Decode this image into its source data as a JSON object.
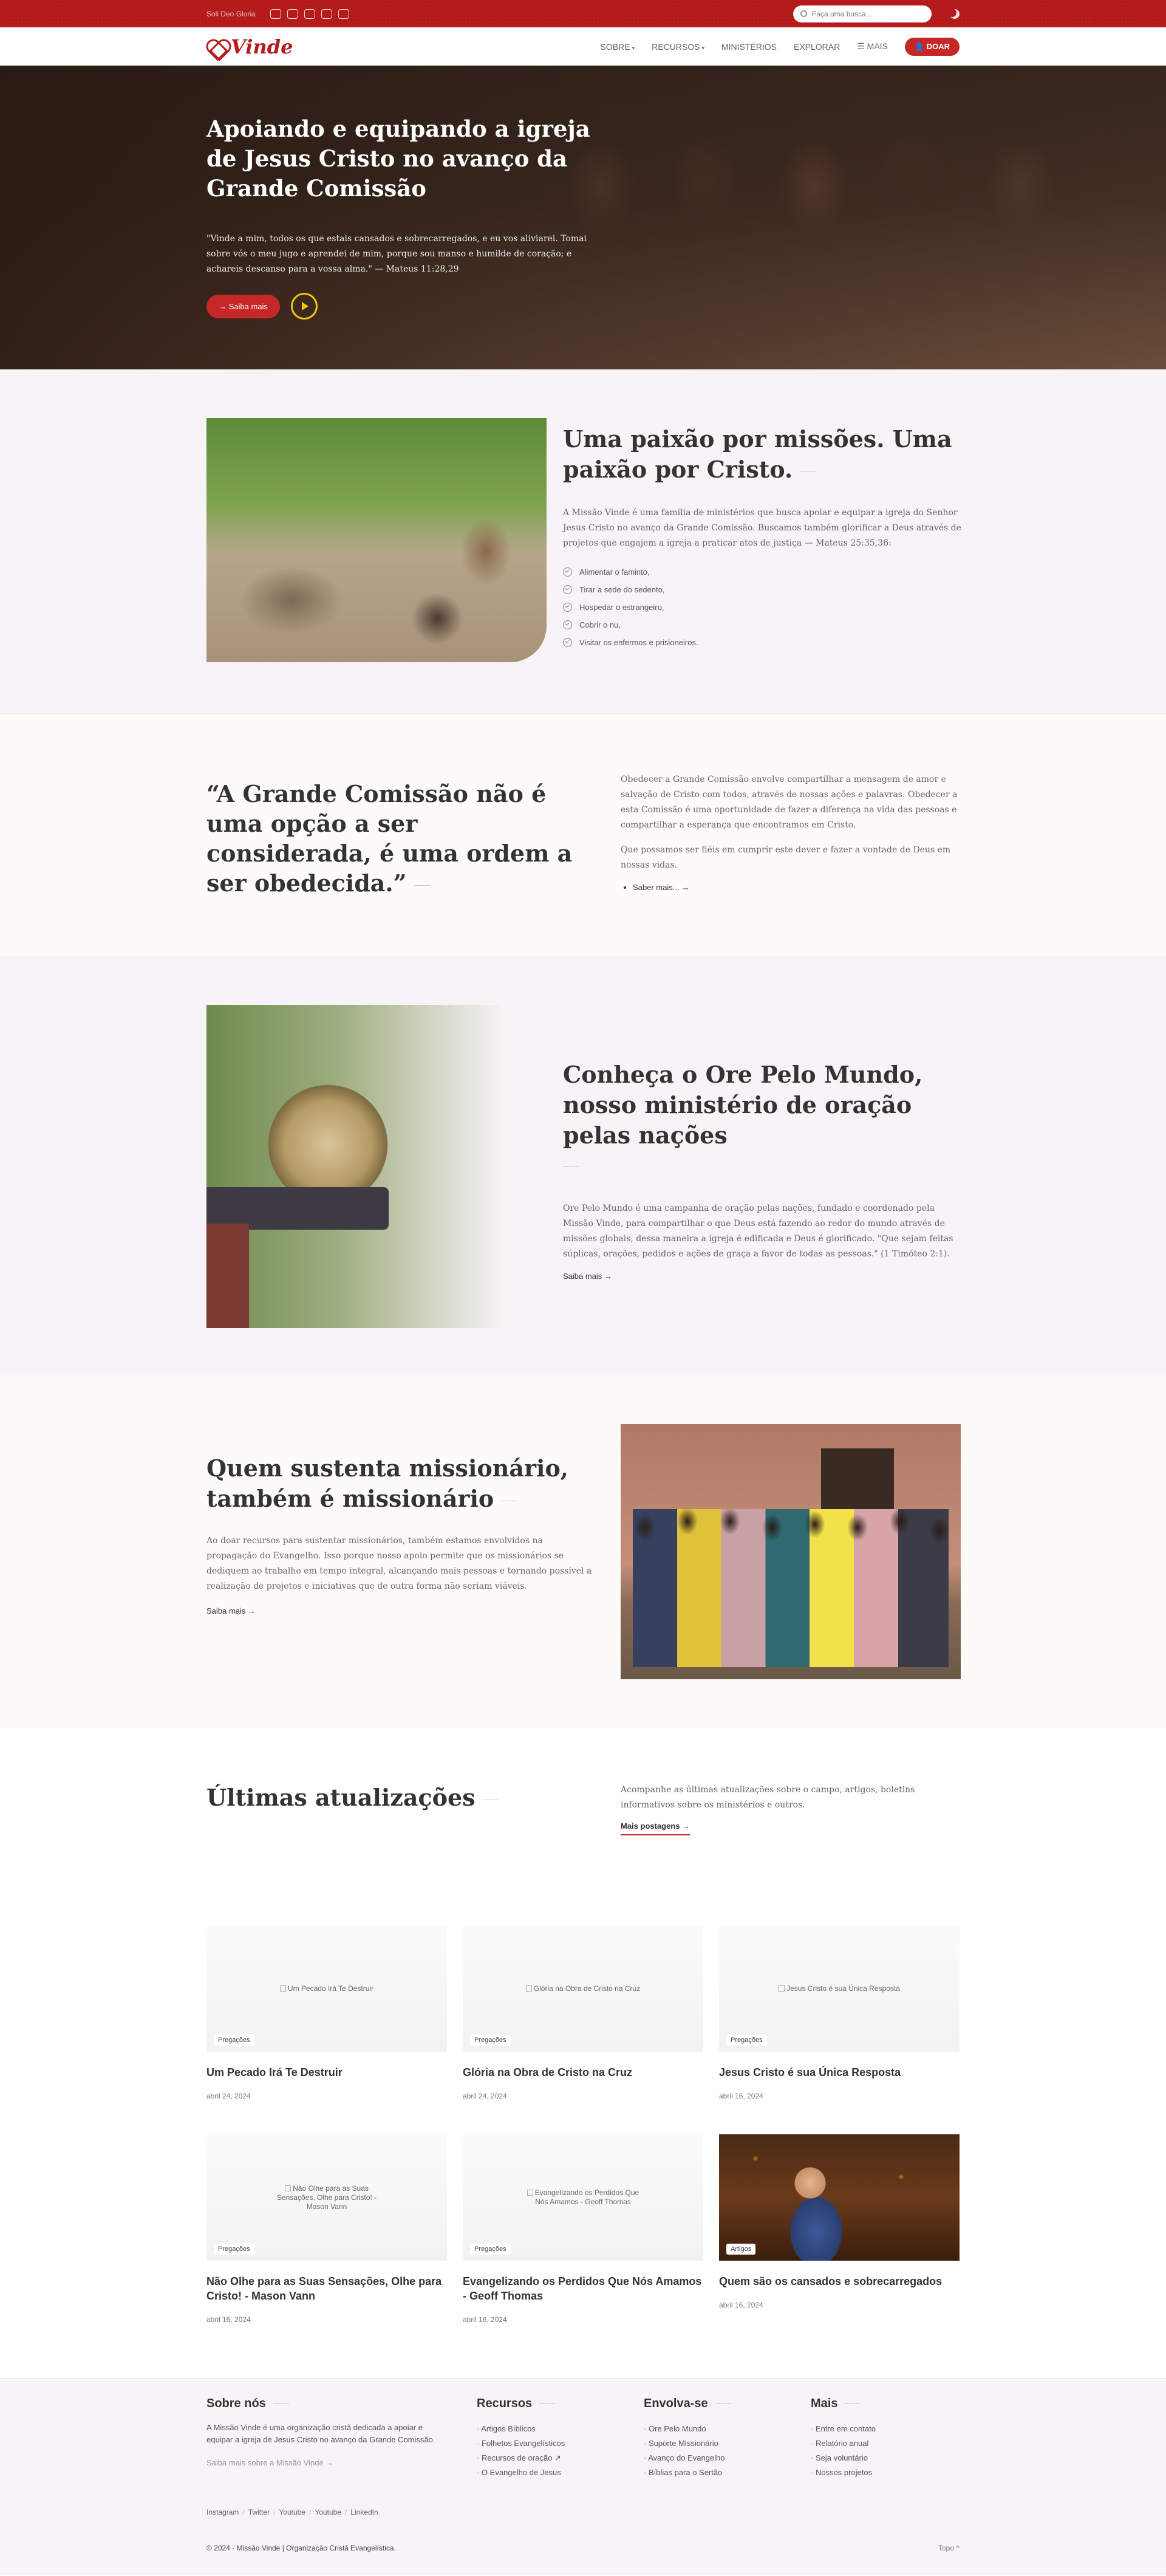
{
  "topbar": {
    "motto": "Soli Deo Gloria",
    "socials": [
      "facebook-icon",
      "bluesky-icon",
      "instagram-icon",
      "youtube-icon",
      "telegram-icon"
    ],
    "search_placeholder": "Faça uma busca..."
  },
  "header": {
    "brand": "Vinde",
    "nav": [
      {
        "label": "SOBRE",
        "dropdown": true
      },
      {
        "label": "RECURSOS",
        "dropdown": true
      },
      {
        "label": "MINISTÉRIOS",
        "dropdown": false
      },
      {
        "label": "EXPLORAR",
        "dropdown": false
      },
      {
        "label": "☰ MAIS",
        "dropdown": false
      }
    ],
    "donate": "DOAR"
  },
  "hero": {
    "title": "Apoiando e equipando a igreja de Jesus Cristo no avanço da Grande Comissão",
    "quote": "\"Vinde a mim, todos os que estais cansados e sobrecarregados, e eu vos aliviarei. Tomai sobre vós o meu jugo e aprendei de mim, porque sou manso e humilde de coração; e achareis descanso para a vossa alma.\" — Mateus 11:28,29",
    "cta": "→ Saiba mais"
  },
  "mission": {
    "title": "Uma paixão por missões. Uma paixão por Cristo.",
    "body": "A Missão Vinde é uma família de ministérios que busca apoiar e equipar a igreja do Senhor Jesus Cristo no avanço da Grande Comissão. Buscamos também glorificar a Deus através de projetos que engajem a igreja a praticar atos de justiça — Mateus 25:35,36:",
    "items": [
      "Alimentar o faminto,",
      "Tirar a sede do sedento,",
      "Hospedar o estrangeiro,",
      "Cobrir o nu,",
      "Visitar os enfermos e prisioneiros."
    ]
  },
  "commission": {
    "quote": "“A Grande Comissão não é uma opção a ser considerada, é uma ordem a ser obedecida.”",
    "p1": "Obedecer a Grande Comissão envolve compartilhar a mensagem de amor e salvação de Cristo com todos, através de nossas ações e palavras. Obedecer a esta Comissão é uma oportunidade de fazer a diferença na vida das pessoas e compartilhar a esperança que encontramos em Cristo.",
    "p2": "Que possamos ser fiéis em cumprir este dever e fazer a vontade de Deus em nossas vidas.",
    "link": "Saber mais...  →"
  },
  "prayer": {
    "title": "Conheça o Ore Pelo Mundo, nosso ministério de oração pelas nações",
    "body": "Ore Pelo Mundo é uma campanha de oração pelas nações, fundado e coordenado pela Missão Vinde, para compartilhar o que Deus está fazendo ao redor do mundo através de missões globais, dessa maneira a igreja é edificada e Deus é glorificado. \"Que sejam feitas súplicas, orações, pedidos e ações de graça a favor de todas as pessoas.\" (1 Timóteo 2:1).",
    "link": "Saiba mais  →"
  },
  "support": {
    "title": "Quem sustenta missionário, também é missionário",
    "body": "Ao doar recursos para sustentar missionários, também estamos envolvidos na propagação do Evangelho. Isso porque nosso apoio permite que os missionários se dediquem ao trabalho em tempo integral, alcançando mais pessoas e tornando possível a realização de projetos e iniciativas que de outra forma não seriam viáveis.",
    "link": "Saiba mais  →"
  },
  "updates": {
    "title": "Últimas atualizações",
    "intro": "Acompanhe as últimas atualizações sobre o campo, artigos, boletins informativos sobre os ministérios e outros.",
    "more": "Mais postagens  →",
    "cards": [
      {
        "alt": "Um Pecado Irá Te Destruir",
        "tag": "Pregações",
        "title": "Um Pecado Irá Te Destruir",
        "date": "abril 24, 2024"
      },
      {
        "alt": "Glória na Obra de Cristo na Cruz",
        "tag": "Pregações",
        "title": "Glória na Obra de Cristo na Cruz",
        "date": "abril 24, 2024"
      },
      {
        "alt": "Jesus Cristo é sua Única Resposta",
        "tag": "Pregações",
        "title": "Jesus Cristo é sua Única Resposta",
        "date": "abril 16, 2024"
      },
      {
        "alt": "Não Olhe para as Suas Sensações, Olhe para Cristo! - Mason Vann",
        "tag": "Pregações",
        "title": "Não Olhe para as Suas Sensações, Olhe para Cristo! - Mason Vann",
        "date": "abril 16, 2024"
      },
      {
        "alt": "Evangelizando os Perdidos Que Nós Amamos - Geoff Thomas",
        "tag": "Pregações",
        "title": "Evangelizando os Perdidos Que Nós Amamos - Geoff Thomas",
        "date": "abril 16, 2024"
      },
      {
        "alt": "",
        "tag": "Artigos",
        "title": "Quem são os cansados e sobrecarregados",
        "date": "abril 16, 2024"
      }
    ]
  },
  "footer": {
    "about_title": "Sobre nós",
    "about_text": "A Missão Vinde é uma organização cristã dedicada a apoiar e equipar a igreja de Jesus Cristo no avanço da Grande Comissão.",
    "about_link": "Saiba mais sobre a Missão Vinde →",
    "resources_title": "Recursos",
    "resources": [
      "Artigos Bíblicos",
      "Folhetos Evangelísticos",
      "Recursos de oração ↗",
      "O Evangelho de Jesus"
    ],
    "involve_title": "Envolva-se",
    "involve": [
      "Ore Pelo Mundo",
      "Suporte Missionário",
      "Avanço do Evangelho",
      "Bíblias para o Sertão"
    ],
    "more_title": "Mais",
    "more": [
      "Entre em contato",
      "Relatório anual",
      "Seja voluntário",
      "Nossos projetos"
    ],
    "socials": [
      "Instagram",
      "Twitter",
      "Youtube",
      "Youtube",
      "LinkedIn"
    ],
    "copyright": "© 2024 · Missão Vinde | Organização Cristã Evangelística.",
    "top": "Topo ^"
  }
}
